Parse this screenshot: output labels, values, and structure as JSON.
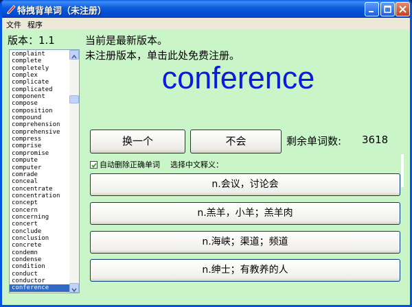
{
  "window": {
    "title": "特拽背单词（未注册）"
  },
  "menu": [
    "文件",
    "程序"
  ],
  "version_text": "版本：1.1",
  "status_line1": "当前是最新版本。",
  "status_line2": "未注册版本，单击此处免费注册。",
  "current_word": "conference",
  "buttons": {
    "next": "换一个",
    "dont_know": "不会"
  },
  "remaining": {
    "label": "剩余单词数:",
    "count": "3618"
  },
  "auto_delete": {
    "label": "自动删除正确单词",
    "checked": true
  },
  "choose_label": "选择中文释义：",
  "choices": [
    "n.会议，讨论会",
    "n.羔羊，小羊；羔羊肉",
    "n.海峡；渠道；频道",
    "n.绅士；有教养的人"
  ],
  "word_list": [
    "complaint",
    "complete",
    "completely",
    "complex",
    "complicate",
    "complicated",
    "component",
    "compose",
    "composition",
    "compound",
    "comprehension",
    "comprehensive",
    "compress",
    "comprise",
    "compromise",
    "compute",
    "computer",
    "comrade",
    "conceal",
    "concentrate",
    "concentration",
    "concept",
    "concern",
    "concerning",
    "concert",
    "conclude",
    "conclusion",
    "concrete",
    "condemn",
    "condense",
    "condition",
    "conduct",
    "conductor",
    "conference"
  ],
  "selected_word_index": 33,
  "colors": {
    "window_bg": "#c9f5c9",
    "word_color": "#0a1ae0",
    "selection": "#316ac5"
  }
}
